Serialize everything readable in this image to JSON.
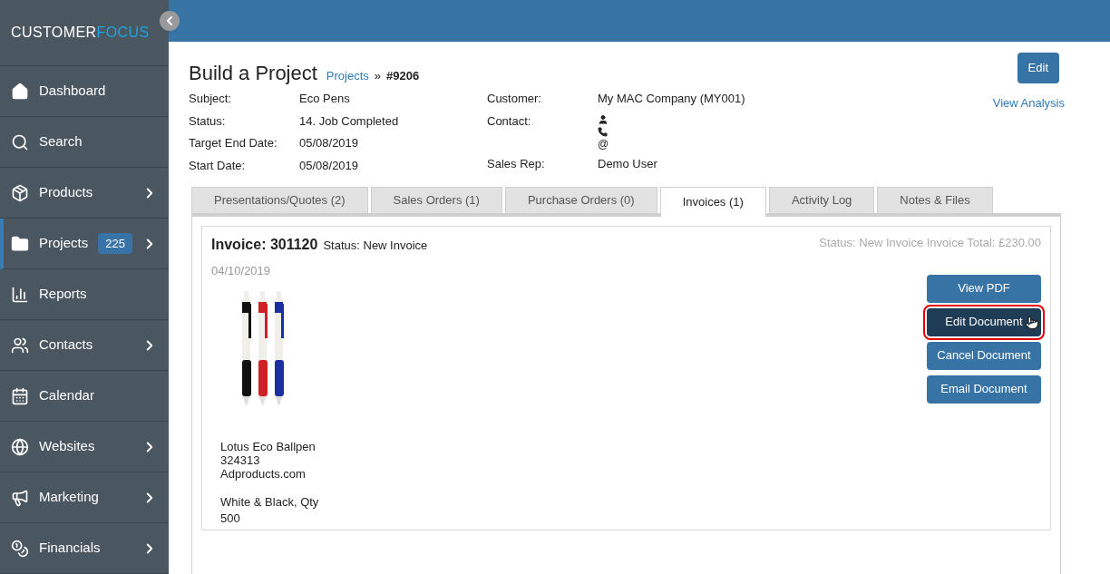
{
  "sidebar": {
    "logo": {
      "first": "CUSTOMER",
      "second": "FOCUS"
    },
    "items": [
      {
        "label": "Dashboard",
        "has_submenu": false,
        "selected": false
      },
      {
        "label": "Search",
        "has_submenu": false,
        "selected": false
      },
      {
        "label": "Products",
        "has_submenu": true,
        "selected": false
      },
      {
        "label": "Projects",
        "badge": "225",
        "has_submenu": true,
        "selected": true
      },
      {
        "label": "Reports",
        "has_submenu": false,
        "selected": false
      },
      {
        "label": "Contacts",
        "has_submenu": true,
        "selected": false
      },
      {
        "label": "Calendar",
        "has_submenu": false,
        "selected": false
      },
      {
        "label": "Websites",
        "has_submenu": true,
        "selected": false
      },
      {
        "label": "Marketing",
        "has_submenu": true,
        "selected": false
      },
      {
        "label": "Financials",
        "has_submenu": true,
        "selected": false
      }
    ]
  },
  "header": {
    "title": "Build a Project",
    "breadcrumb_link": "Projects",
    "breadcrumb_sep": "»",
    "breadcrumb_current": "#9206",
    "edit_button": "Edit",
    "analysis_link": "View Analysis"
  },
  "details_left": [
    {
      "label": "Subject:",
      "value": "Eco Pens"
    },
    {
      "label": "Status:",
      "value": "14. Job Completed"
    },
    {
      "label": "Target End Date:",
      "value": "05/08/2019"
    },
    {
      "label": "Start Date:",
      "value": "05/08/2019"
    }
  ],
  "details_right": {
    "customer_label": "Customer:",
    "customer": "My MAC Company (MY001)",
    "contact_label": "Contact:",
    "contact_email": "@",
    "sales_rep_label": "Sales Rep:",
    "sales_rep": "Demo User"
  },
  "tabs": [
    {
      "label": "Presentations/Quotes (2)",
      "selected": false
    },
    {
      "label": "Sales Orders (1)",
      "selected": false
    },
    {
      "label": "Purchase Orders (0)",
      "selected": false
    },
    {
      "label": "Invoices (1)",
      "selected": true
    },
    {
      "label": "Activity Log",
      "selected": false
    },
    {
      "label": "Notes & Files",
      "selected": false
    }
  ],
  "invoice": {
    "title": "Invoice: 301120",
    "status": "Status: New Invoice",
    "summary": "Status: New Invoice Invoice Total: £230.00",
    "date": "04/10/2019",
    "product": {
      "name": "Lotus Eco Ballpen",
      "code": "324313",
      "supplier": "Adproducts.com",
      "variant": "White & Black, Qty",
      "qty": "500"
    },
    "buttons": [
      {
        "label": "View PDF",
        "highlighted": false
      },
      {
        "label": "Edit Document",
        "highlighted": true
      },
      {
        "label": "Cancel Document",
        "highlighted": false
      },
      {
        "label": "Email Document",
        "highlighted": false
      }
    ]
  }
}
